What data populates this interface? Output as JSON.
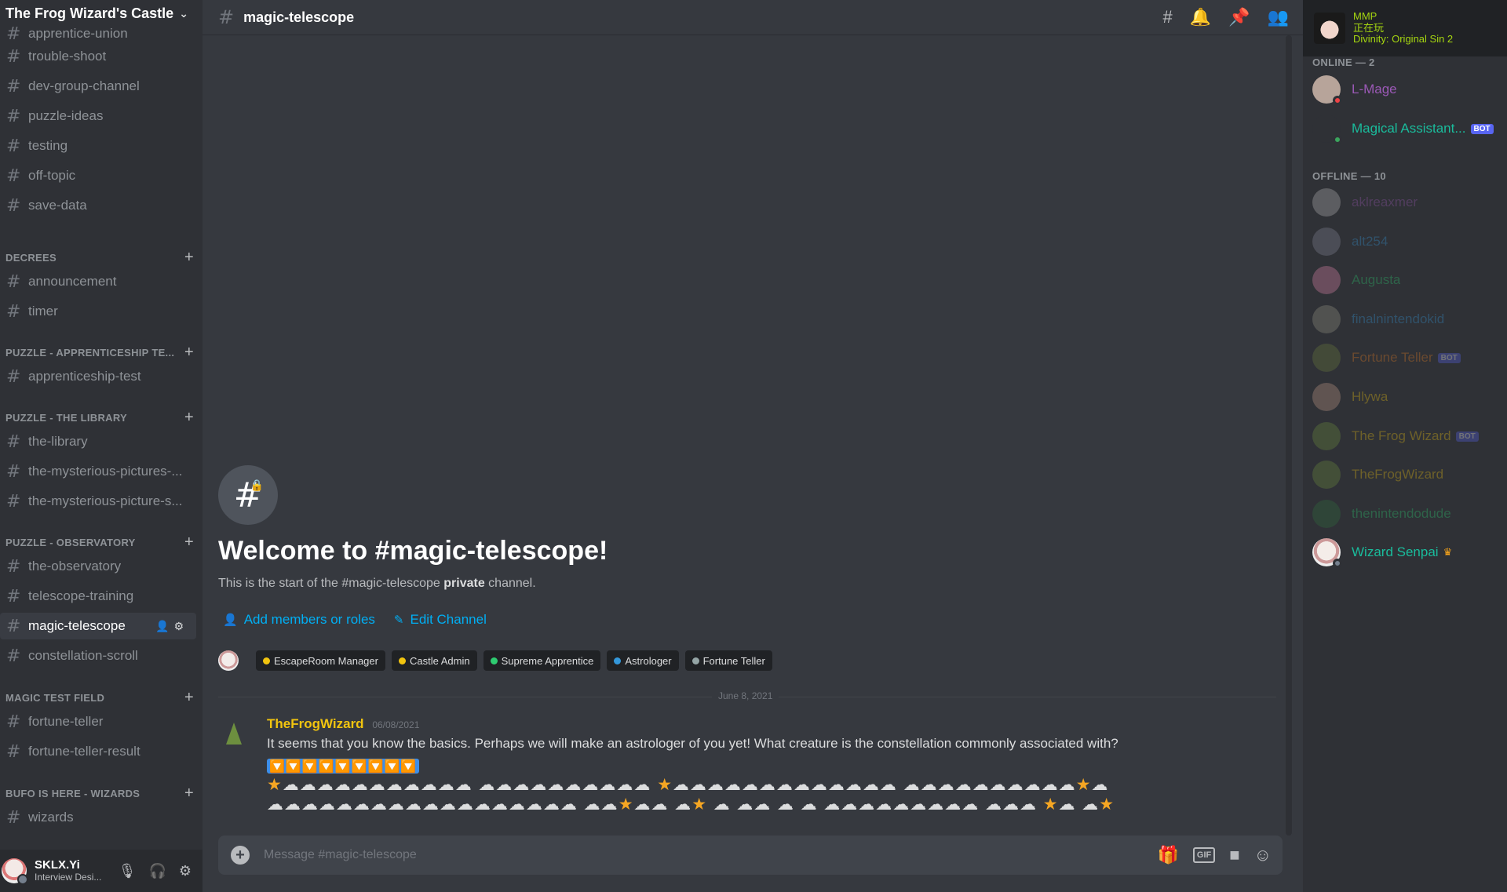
{
  "server": {
    "name": "The Frog Wizard's Castle"
  },
  "sidebar": {
    "channels_top": [
      "apprentice-union",
      "trouble-shoot",
      "dev-group-channel",
      "puzzle-ideas",
      "testing",
      "off-topic",
      "save-data"
    ],
    "cat_decrees": "DECREES",
    "decrees": [
      "announcement",
      "timer"
    ],
    "cat_apprentice": "PUZZLE - APPRENTICESHIP TE...",
    "apprentice": [
      "apprenticeship-test"
    ],
    "cat_library": "PUZZLE - THE LIBRARY",
    "library": [
      "the-library",
      "the-mysterious-pictures-...",
      "the-mysterious-picture-s..."
    ],
    "cat_observatory": "PUZZLE - OBSERVATORY",
    "observatory": [
      "the-observatory",
      "telescope-training",
      "magic-telescope",
      "constellation-scroll"
    ],
    "cat_magic": "MAGIC TEST FIELD",
    "magic": [
      "fortune-teller",
      "fortune-teller-result"
    ],
    "cat_bufo": "BUFO IS HERE - WIZARDS",
    "bufo": [
      "wizards"
    ]
  },
  "user": {
    "name": "SKLX.Yi",
    "status": "Interview Desi..."
  },
  "channel": {
    "name": "magic-telescope"
  },
  "welcome": {
    "title": "Welcome to #magic-telescope!",
    "sub_before": "This is the start of the #magic-telescope ",
    "sub_bold": "private",
    "sub_after": " channel.",
    "add_members": "Add members or roles",
    "edit_channel": "Edit Channel"
  },
  "roles": [
    {
      "name": "EscapeRoom Manager",
      "color": "#f1c40f"
    },
    {
      "name": "Castle Admin",
      "color": "#f1c40f"
    },
    {
      "name": "Supreme Apprentice",
      "color": "#2ecc71"
    },
    {
      "name": "Astrologer",
      "color": "#3498db"
    },
    {
      "name": "Fortune Teller",
      "color": "#95a5a6"
    }
  ],
  "date_divider": "June 8, 2021",
  "message": {
    "author": "TheFrogWizard",
    "time": "06/08/2021",
    "text": "It seems that you know the basics. Perhaps we will make an astrologer of you yet! What creature is the constellation commonly associated with?",
    "row1": "🔽🔽🔽🔽🔽🔽🔽🔽🔽",
    "row2": "⭐☁☁☁☁☁☁☁☁☁☁☁ ☁☁☁☁☁☁☁☁☁☁ ⭐☁☁☁☁☁☁☁☁☁☁☁☁☁ ☁☁☁☁☁☁☁☁☁☁⭐☁",
    "row3": "☁☁☁☁☁☁☁☁☁☁☁☁☁☁☁☁☁☁ ☁☁⭐☁☁ ☁⭐ ☁ ☁☁ ☁ ☁ ☁☁☁☁☁☁☁☁☁ ☁☁☁ ⭐☁ ☁⭐"
  },
  "composer": {
    "placeholder": "Message #magic-telescope",
    "gif": "GIF"
  },
  "activity": {
    "name": "MMP",
    "line1": "正在玩",
    "line2": "Divinity: Original Sin 2"
  },
  "members": {
    "online_label": "ONLINE — 2",
    "offline_label": "OFFLINE — 10",
    "bot_tag": "BOT",
    "online": [
      {
        "name": "L-Mage",
        "color": "#9b59b6",
        "status": "#ed4245",
        "bot": false
      },
      {
        "name": "Magical Assistant...",
        "color": "#1abc9c",
        "status": "#3ba55d",
        "bot": true
      }
    ],
    "offline": [
      {
        "name": "aklreaxmer",
        "color": "#9b59b6",
        "bot": false
      },
      {
        "name": "alt254",
        "color": "#3498db",
        "bot": false
      },
      {
        "name": "Augusta",
        "color": "#2ecc71",
        "bot": false
      },
      {
        "name": "finalnintendokid",
        "color": "#3498db",
        "bot": false
      },
      {
        "name": "Fortune Teller",
        "color": "#e67e22",
        "bot": true
      },
      {
        "name": "Hlywa",
        "color": "#f1c40f",
        "bot": false
      },
      {
        "name": "The Frog Wizard",
        "color": "#f1c40f",
        "bot": true
      },
      {
        "name": "TheFrogWizard",
        "color": "#f1c40f",
        "bot": false
      },
      {
        "name": "thenintendodude",
        "color": "#2ecc71",
        "bot": false
      }
    ],
    "senpai": {
      "name": "Wizard Senpai",
      "color": "#1abc9c"
    }
  }
}
